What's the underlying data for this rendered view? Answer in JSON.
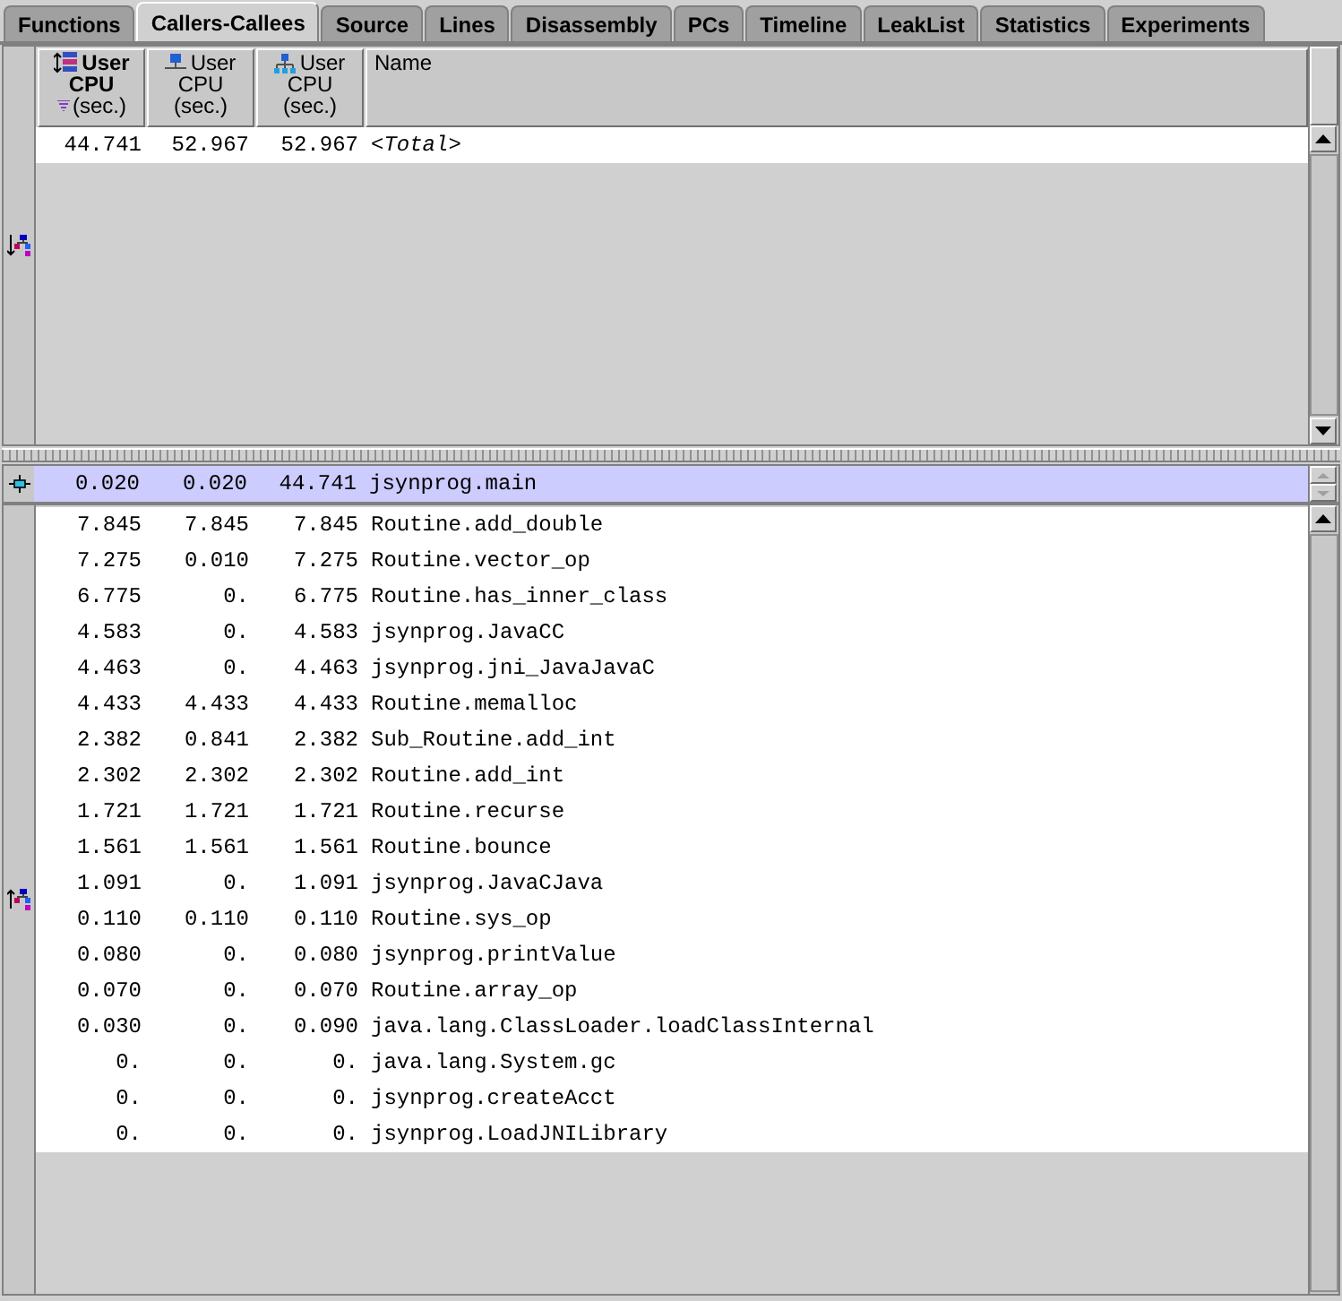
{
  "tabs": [
    {
      "label": "Functions",
      "selected": false
    },
    {
      "label": "Callers-Callees",
      "selected": true
    },
    {
      "label": "Source",
      "selected": false
    },
    {
      "label": "Lines",
      "selected": false
    },
    {
      "label": "Disassembly",
      "selected": false
    },
    {
      "label": "PCs",
      "selected": false
    },
    {
      "label": "Timeline",
      "selected": false
    },
    {
      "label": "LeakList",
      "selected": false
    },
    {
      "label": "Statistics",
      "selected": false
    },
    {
      "label": "Experiments",
      "selected": false
    }
  ],
  "columns": [
    {
      "kind": "exclusive",
      "lines": [
        "User",
        "CPU",
        "(sec.)"
      ],
      "sorted": true
    },
    {
      "kind": "inclusive",
      "lines": [
        "User",
        "CPU",
        "(sec.)"
      ],
      "sorted": false
    },
    {
      "kind": "attributed",
      "lines": [
        "User",
        "CPU",
        "(sec.)"
      ],
      "sorted": false
    },
    {
      "kind": "name",
      "lines": [
        "Name"
      ],
      "sorted": false
    }
  ],
  "callers": [
    {
      "values": [
        "44.741",
        "52.967",
        "52.967"
      ],
      "name": "<Total>",
      "italic": true
    }
  ],
  "center": {
    "values": [
      "0.020",
      "0.020",
      "44.741"
    ],
    "name": "jsynprog.main"
  },
  "callees": [
    {
      "values": [
        "7.845",
        "7.845",
        "7.845"
      ],
      "name": "Routine.add_double"
    },
    {
      "values": [
        "7.275",
        "0.010",
        "7.275"
      ],
      "name": "Routine.vector_op"
    },
    {
      "values": [
        "6.775",
        "0.",
        "6.775"
      ],
      "name": "Routine.has_inner_class"
    },
    {
      "values": [
        "4.583",
        "0.",
        "4.583"
      ],
      "name": "jsynprog.JavaCC"
    },
    {
      "values": [
        "4.463",
        "0.",
        "4.463"
      ],
      "name": "jsynprog.jni_JavaJavaC"
    },
    {
      "values": [
        "4.433",
        "4.433",
        "4.433"
      ],
      "name": "Routine.memalloc"
    },
    {
      "values": [
        "2.382",
        "0.841",
        "2.382"
      ],
      "name": "Sub_Routine.add_int"
    },
    {
      "values": [
        "2.302",
        "2.302",
        "2.302"
      ],
      "name": "Routine.add_int"
    },
    {
      "values": [
        "1.721",
        "1.721",
        "1.721"
      ],
      "name": "Routine.recurse"
    },
    {
      "values": [
        "1.561",
        "1.561",
        "1.561"
      ],
      "name": "Routine.bounce"
    },
    {
      "values": [
        "1.091",
        "0.",
        "1.091"
      ],
      "name": "jsynprog.JavaCJava"
    },
    {
      "values": [
        "0.110",
        "0.110",
        "0.110"
      ],
      "name": "Routine.sys_op"
    },
    {
      "values": [
        "0.080",
        "0.",
        "0.080"
      ],
      "name": "jsynprog.printValue"
    },
    {
      "values": [
        "0.070",
        "0.",
        "0.070"
      ],
      "name": "Routine.array_op"
    },
    {
      "values": [
        "0.030",
        "0.",
        "0.090"
      ],
      "name": "java.lang.ClassLoader.loadClassInternal"
    },
    {
      "values": [
        "0.",
        "0.",
        "0."
      ],
      "name": "java.lang.System.gc"
    },
    {
      "values": [
        "0.",
        "0.",
        "0."
      ],
      "name": "jsynprog.createAcct"
    },
    {
      "values": [
        "0.",
        "0.",
        "0."
      ],
      "name": "jsynprog.LoadJNILibrary"
    }
  ]
}
